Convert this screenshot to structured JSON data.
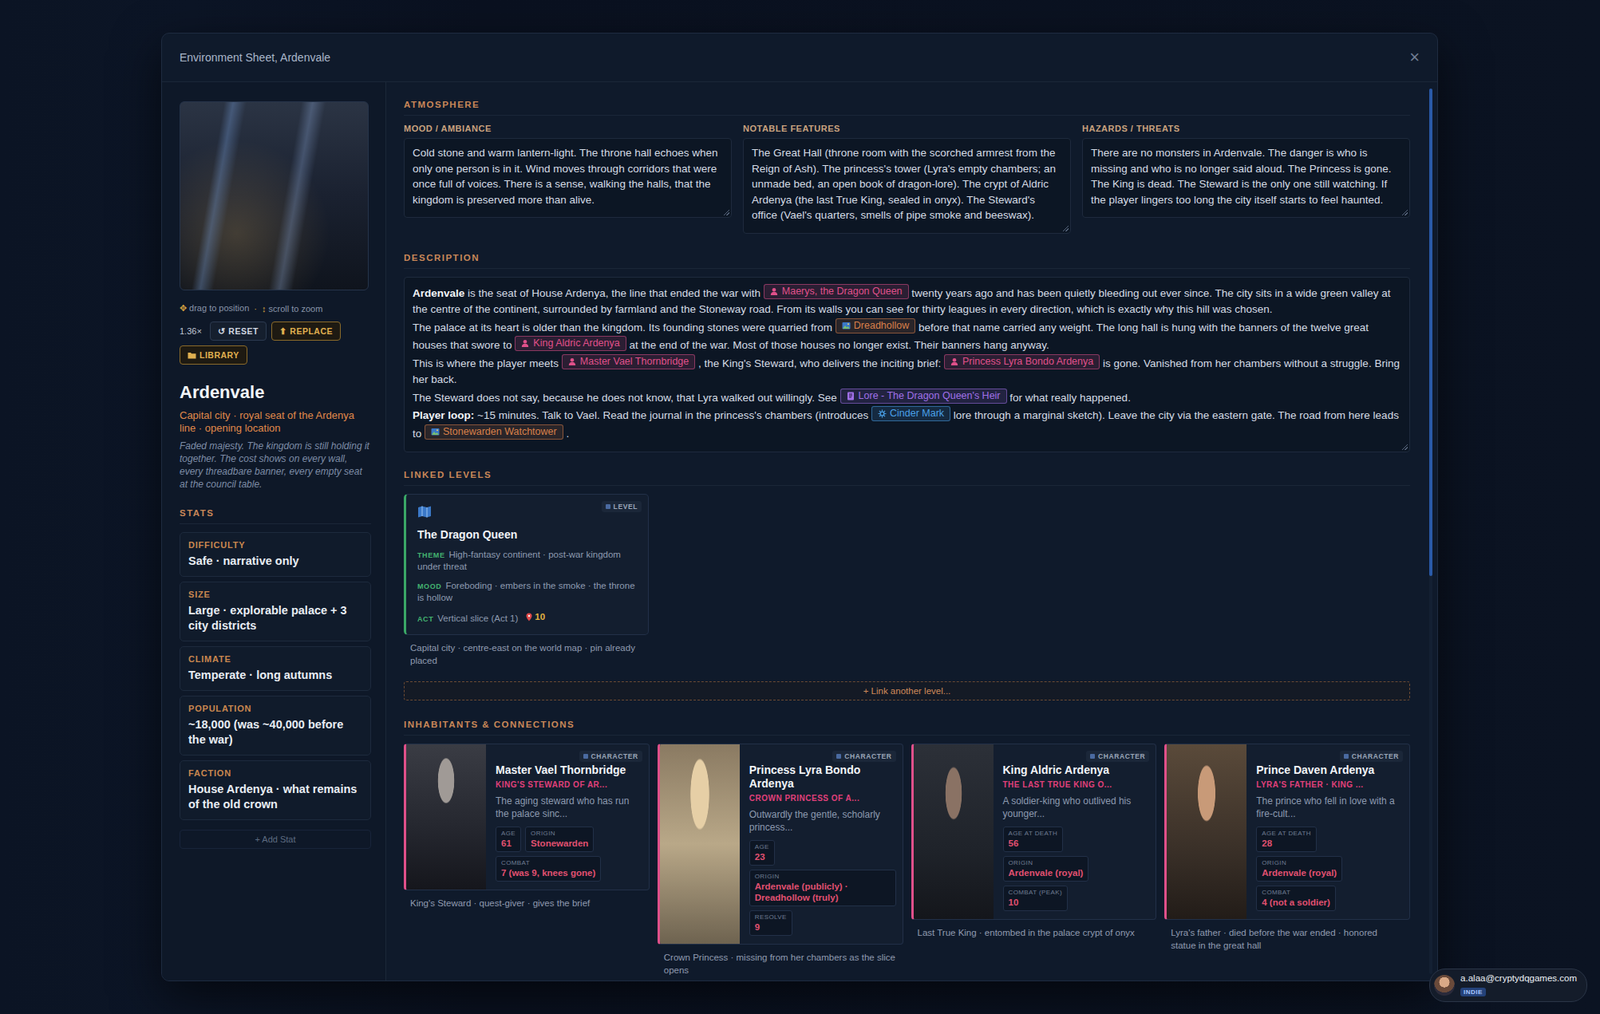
{
  "modal": {
    "title": "Environment Sheet, Ardenvale",
    "close": "×"
  },
  "sidebar": {
    "hints": [
      {
        "icon": "✥",
        "text": "drag to position"
      },
      {
        "icon": "·",
        "text": ""
      },
      {
        "icon": "↕",
        "text": "scroll to zoom"
      }
    ],
    "zoom": "1.36×",
    "buttons": [
      {
        "icon": "↺",
        "label": "RESET",
        "kind": "plain"
      },
      {
        "icon": "⬆",
        "label": "REPLACE",
        "kind": "gold"
      },
      {
        "icon": "",
        "label": "LIBRARY",
        "kind": "gold"
      }
    ],
    "name": "Ardenvale",
    "subtitle": "Capital city · royal seat of the Ardenya line · opening location",
    "tagline": "Faded majesty. The kingdom is still holding it together. The cost shows on every wall, every threadbare banner, every empty seat at the council table.",
    "stats_title": "STATS",
    "stats": [
      {
        "label": "DIFFICULTY",
        "value": "Safe · narrative only"
      },
      {
        "label": "SIZE",
        "value": "Large · explorable palace + 3 city districts"
      },
      {
        "label": "CLIMATE",
        "value": "Temperate · long autumns"
      },
      {
        "label": "POPULATION",
        "value": "~18,000 (was ~40,000 before the war)"
      },
      {
        "label": "FACTION",
        "value": "House Ardenya · what remains of the old crown"
      }
    ],
    "add_stat": "+ Add Stat"
  },
  "scrollbar": {
    "level": 0.55
  },
  "atmosphere": {
    "title": "ATMOSPHERE",
    "fields": [
      {
        "label": "MOOD / AMBIANCE",
        "value": "Cold stone and warm lantern-light. The throne hall echoes when only one person is in it. Wind moves through corridors that were once full of voices. There is a sense, walking the halls, that the kingdom is preserved more than alive."
      },
      {
        "label": "NOTABLE FEATURES",
        "value": "The Great Hall (throne room with the scorched armrest from the Reign of Ash). The princess's tower (Lyra's empty chambers; an unmade bed, an open book of dragon-lore). The crypt of Aldric Ardenya (the last True King, sealed in onyx). The Steward's office (Vael's quarters, smells of pipe smoke and beeswax)."
      },
      {
        "label": "HAZARDS / THREATS",
        "value": "There are no monsters in Ardenvale. The danger is who is missing and who is no longer said aloud. The Princess is gone. The King is dead. The Steward is the only one still watching. If the player lingers too long the city itself starts to feel haunted."
      }
    ]
  },
  "description": {
    "title": "DESCRIPTION",
    "paragraphs": [
      [
        {
          "kind": "bold",
          "text": "Ardenvale"
        },
        {
          "kind": "text",
          "text": " is the seat of House Ardenya, the line that ended the war with "
        },
        {
          "kind": "character",
          "text": "Maerys, the Dragon Queen",
          "color": "#e0508a"
        },
        {
          "kind": "text",
          "text": " twenty years ago and has been quietly bleeding out ever since. The city sits in a wide green valley at the centre of the continent, surrounded by farmland and the Stoneway road. From its walls you can see for thirty leagues in every direction, which is exactly why this hill was chosen."
        }
      ],
      [
        {
          "kind": "text",
          "text": "The palace at its heart is older than the kingdom. Its founding stones were quarried from "
        },
        {
          "kind": "location",
          "text": "Dreadhollow",
          "color": "#d9804a"
        },
        {
          "kind": "text",
          "text": " before that name carried any weight. The long hall is hung with the banners of the twelve great houses that swore to "
        },
        {
          "kind": "character",
          "text": "King Aldric Ardenya",
          "color": "#e0508a"
        },
        {
          "kind": "text",
          "text": " at the end of the war. Most of those houses no longer exist. Their banners hang anyway."
        }
      ],
      [
        {
          "kind": "text",
          "text": "This is where the player meets "
        },
        {
          "kind": "character",
          "text": "Master Vael Thornbridge",
          "color": "#e0508a"
        },
        {
          "kind": "text",
          "text": " , the King's Steward, who delivers the inciting brief: "
        },
        {
          "kind": "character",
          "text": "Princess Lyra Bondo Ardenya",
          "color": "#e0508a"
        },
        {
          "kind": "text",
          "text": " is gone. Vanished from her chambers without a struggle. Bring her back."
        }
      ],
      [
        {
          "kind": "text",
          "text": "The Steward does not say, because he does not know, that Lyra walked out willingly. See "
        },
        {
          "kind": "lore",
          "text": "Lore - The Dragon Queen's Heir",
          "color": "#a070e8"
        },
        {
          "kind": "text",
          "text": " for what really happened."
        }
      ],
      [
        {
          "kind": "bold",
          "text": "Player loop:"
        },
        {
          "kind": "text",
          "text": " ~15 minutes. Talk to Vael. Read the journal in the princess's chambers (introduces "
        },
        {
          "kind": "item",
          "text": "Cinder Mark",
          "color": "#4aa0e8"
        },
        {
          "kind": "text",
          "text": " lore through a marginal sketch). Leave the city via the eastern gate. The road from here leads to "
        },
        {
          "kind": "location",
          "text": "Stonewarden Watchtower",
          "color": "#d9804a"
        },
        {
          "kind": "text",
          "text": " ."
        }
      ]
    ]
  },
  "linked_levels": {
    "title": "LINKED LEVELS",
    "levels": [
      {
        "badge": "LEVEL",
        "name": "The Dragon Queen",
        "rows": [
          {
            "label": "THEME",
            "value": "High-fantasy continent · post-war kingdom under threat"
          },
          {
            "label": "MOOD",
            "value": "Foreboding · embers in the smoke · the throne is hollow"
          },
          {
            "label": "ACT",
            "value": "Vertical slice (Act 1)"
          }
        ],
        "pin": "10",
        "note": "Capital city · centre-east on the world map · pin already placed"
      }
    ],
    "link_button": "+ Link another level..."
  },
  "inhabitants": {
    "title": "INHABITANTS & CONNECTIONS",
    "cards": [
      {
        "badge": "CHARACTER",
        "name": "Master Vael Thornbridge",
        "role": "KING'S STEWARD OF AR...",
        "blurb": "The aging steward who has run the palace sinc...",
        "stats": [
          {
            "label": "AGE",
            "value": "61"
          },
          {
            "label": "ORIGIN",
            "value": "Stonewarden"
          },
          {
            "label": "COMBAT",
            "value": "7 (was 9, knees gone)"
          }
        ],
        "note": "King's Steward · quest-giver · gives the brief"
      },
      {
        "badge": "CHARACTER",
        "name": "Princess Lyra Bondo Ardenya",
        "role": "CROWN PRINCESS OF A...",
        "blurb": "Outwardly the gentle, scholarly princess...",
        "stats": [
          {
            "label": "AGE",
            "value": "23"
          },
          {
            "label": "ORIGIN",
            "value": "Ardenvale (publicly) · Dreadhollow (truly)"
          },
          {
            "label": "RESOLVE",
            "value": "9"
          }
        ],
        "note": "Crown Princess · missing from her chambers as the slice opens"
      },
      {
        "badge": "CHARACTER",
        "name": "King Aldric Ardenya",
        "role": "THE LAST TRUE KING O...",
        "blurb": "A soldier-king who outlived his younger...",
        "stats": [
          {
            "label": "AGE AT DEATH",
            "value": "56"
          },
          {
            "label": "ORIGIN",
            "value": "Ardenvale (royal)"
          },
          {
            "label": "COMBAT (PEAK)",
            "value": "10"
          }
        ],
        "note": "Last True King · entombed in the palace crypt of onyx"
      },
      {
        "badge": "CHARACTER",
        "name": "Prince Daven Ardenya",
        "role": "LYRA'S FATHER · KING ...",
        "blurb": "The prince who fell in love with a fire-cult...",
        "stats": [
          {
            "label": "AGE AT DEATH",
            "value": "28"
          },
          {
            "label": "ORIGIN",
            "value": "Ardenvale (royal)"
          },
          {
            "label": "COMBAT",
            "value": "4 (not a soldier)"
          }
        ],
        "note": "Lyra's father · died before the war ended · honored statue in the great hall"
      }
    ]
  },
  "user": {
    "email": "a.alaa@cryptydqgames.com",
    "plan": "INDIE"
  }
}
